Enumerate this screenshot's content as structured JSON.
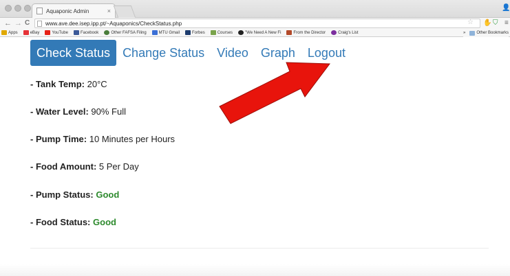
{
  "browser": {
    "tab_title": "Aquaponic Admin",
    "tab_close": "×",
    "url": "www.ave.dee.isep.ipp.pt/~Aquaponics/CheckStatus.php",
    "nav": {
      "back": "←",
      "forward": "→",
      "reload": "C"
    },
    "bookmarks": [
      {
        "label": "Apps",
        "color": "#e0a800"
      },
      {
        "label": "eBay",
        "color": "#e53238"
      },
      {
        "label": "YouTube",
        "color": "#e62117"
      },
      {
        "label": "Facebook",
        "color": "#3b5998"
      },
      {
        "label": "Other FAFSA Filing",
        "color": "#4a7d3b"
      },
      {
        "label": "MTU Gmail",
        "color": "#3b6fd6"
      },
      {
        "label": "Forbes",
        "color": "#1d3c6e"
      },
      {
        "label": "Courses",
        "color": "#7aa34b"
      },
      {
        "label": "\"We Need A New Fi",
        "color": "#222222"
      },
      {
        "label": "From the Director",
        "color": "#b34a2a"
      },
      {
        "label": "Craig's List",
        "color": "#7c2e9e"
      }
    ],
    "overflow": "»",
    "other_bookmarks": "Other Bookmarks"
  },
  "nav": {
    "items": [
      {
        "label": "Check Status",
        "active": true
      },
      {
        "label": "Change Status",
        "active": false
      },
      {
        "label": "Video",
        "active": false
      },
      {
        "label": "Graph",
        "active": false
      },
      {
        "label": "Logout",
        "active": false
      }
    ]
  },
  "status": {
    "tank_temp": {
      "label": "Tank Temp:",
      "value": "20°C"
    },
    "water_level": {
      "label": "Water Level:",
      "value": "90% Full"
    },
    "pump_time": {
      "label": "Pump Time:",
      "value": "10 Minutes per Hours"
    },
    "food_amount": {
      "label": "Food Amount:",
      "value": "5 Per Day"
    },
    "pump_status": {
      "label": "Pump Status:",
      "value": "Good"
    },
    "food_status": {
      "label": "Food Status:",
      "value": "Good"
    }
  },
  "colors": {
    "primary": "#337ab7",
    "good": "#2d8a2d",
    "arrow": "#e8140c"
  }
}
